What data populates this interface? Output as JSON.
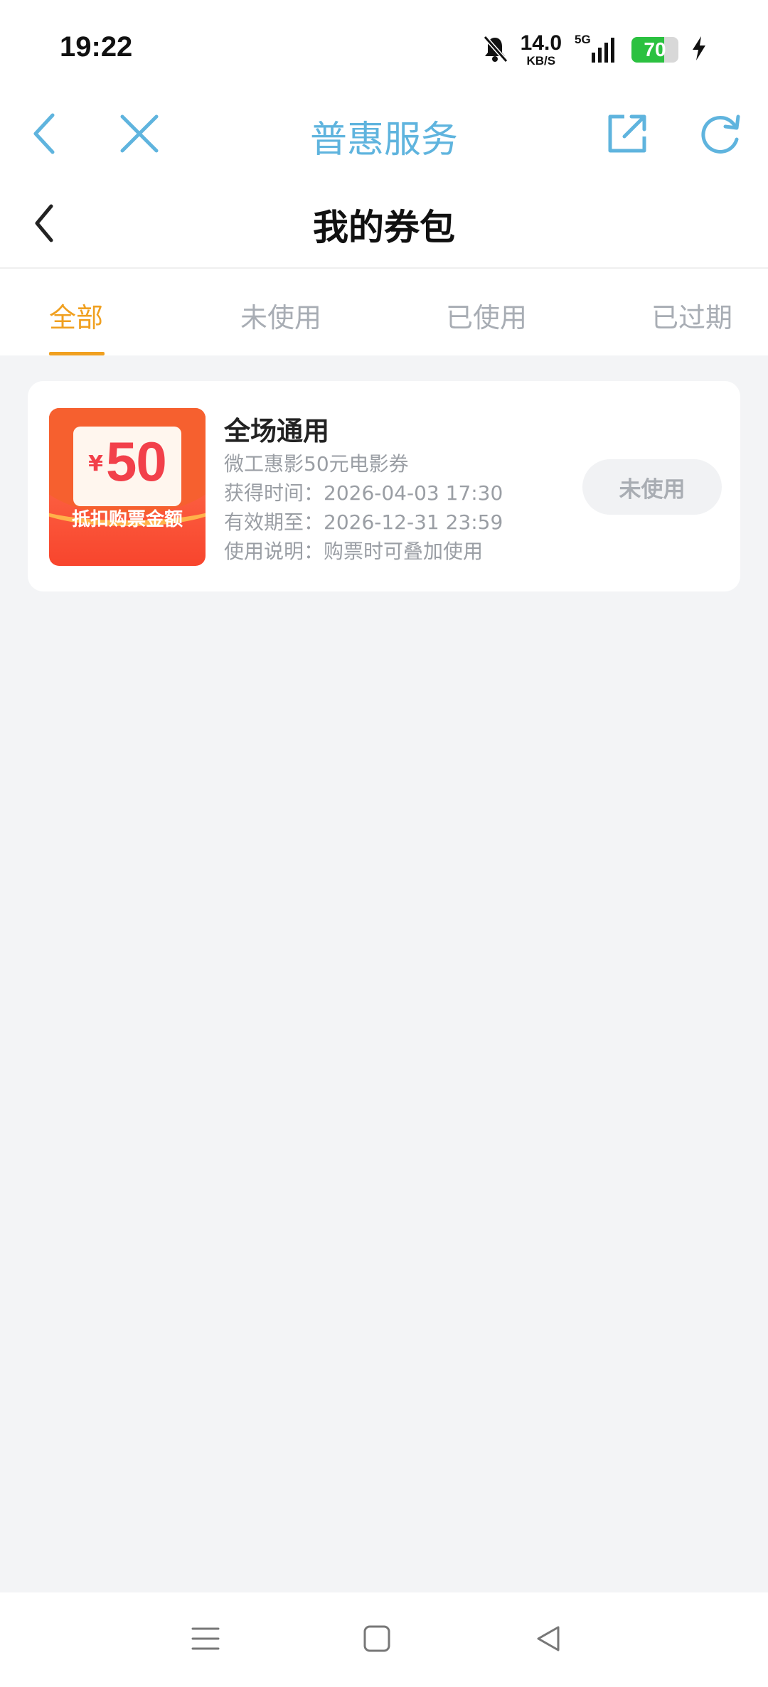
{
  "status_bar": {
    "time": "19:22",
    "net_speed_value": "14.0",
    "net_speed_unit": "KB/S",
    "network_type": "5G",
    "battery_level": "70",
    "icons": [
      "mute-bell-icon",
      "signal-icon",
      "battery-icon",
      "charging-icon"
    ]
  },
  "browser_bar": {
    "title": "普惠服务",
    "icons": [
      "back-icon",
      "close-icon",
      "share-icon",
      "refresh-icon"
    ],
    "icon_color": "#5fb4de"
  },
  "page": {
    "title": "我的券包"
  },
  "tabs": [
    {
      "label": "全部",
      "active": true
    },
    {
      "label": "未使用",
      "active": false
    },
    {
      "label": "已使用",
      "active": false
    },
    {
      "label": "已过期",
      "active": false
    }
  ],
  "accent_color": "#f0a020",
  "coupons": [
    {
      "image": {
        "currency_symbol": "¥",
        "amount": "50",
        "caption": "抵扣购票金额"
      },
      "title": "全场通用",
      "name": "微工惠影50元电影券",
      "obtained_time": "获得时间：2026-04-03 17:30",
      "valid_until": "有效期至：2026-12-31 23:59",
      "usage_note": "使用说明：购票时可叠加使用",
      "status": "未使用"
    }
  ],
  "nav_bar": {
    "icons": [
      "menu-icon",
      "home-icon",
      "back-triangle-icon"
    ]
  }
}
